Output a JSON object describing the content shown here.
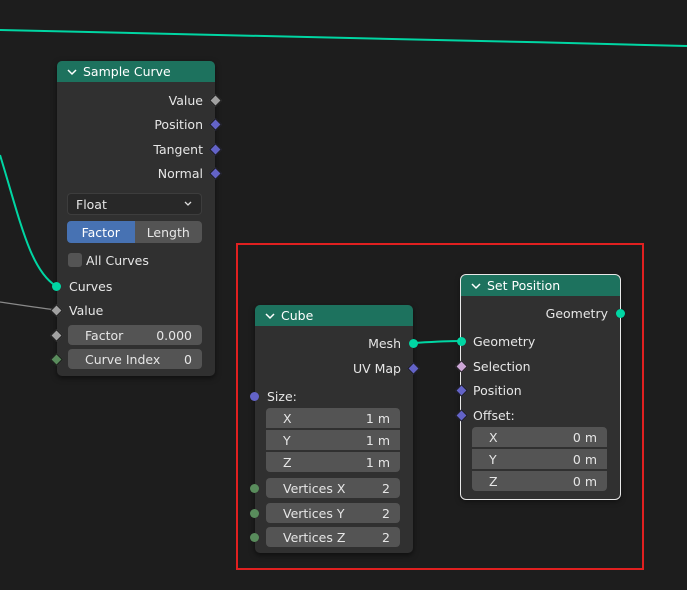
{
  "sample_curve": {
    "title": "Sample Curve",
    "outputs": [
      "Value",
      "Position",
      "Tangent",
      "Normal"
    ],
    "data_type": "Float",
    "mode_options": [
      "Factor",
      "Length"
    ],
    "mode_selected": "Factor",
    "all_curves_label": "All Curves",
    "all_curves_checked": false,
    "inputs": {
      "curves": "Curves",
      "value": "Value",
      "factor_label": "Factor",
      "factor_value": "0.000",
      "curve_index_label": "Curve Index",
      "curve_index_value": "0"
    }
  },
  "cube": {
    "title": "Cube",
    "outputs": {
      "mesh": "Mesh",
      "uv_map": "UV Map"
    },
    "size_label": "Size:",
    "size": [
      {
        "axis": "X",
        "value": "1 m"
      },
      {
        "axis": "Y",
        "value": "1 m"
      },
      {
        "axis": "Z",
        "value": "1 m"
      }
    ],
    "vertices": [
      {
        "label": "Vertices X",
        "value": "2"
      },
      {
        "label": "Vertices Y",
        "value": "2"
      },
      {
        "label": "Vertices Z",
        "value": "2"
      }
    ]
  },
  "set_position": {
    "title": "Set Position",
    "output": "Geometry",
    "inputs": {
      "geometry": "Geometry",
      "selection": "Selection",
      "position": "Position",
      "offset": "Offset:"
    },
    "offset": [
      {
        "axis": "X",
        "value": "0 m"
      },
      {
        "axis": "Y",
        "value": "0 m"
      },
      {
        "axis": "Z",
        "value": "0 m"
      }
    ]
  },
  "colors": {
    "node_header_green": "#1d725e",
    "geometry_socket": "#00d6a3",
    "vector_socket": "#6363c7",
    "float_socket": "#a1a1a1",
    "int_socket": "#598c5c",
    "selection_socket": "#cca6d6",
    "frame_highlight": "#e02020"
  }
}
